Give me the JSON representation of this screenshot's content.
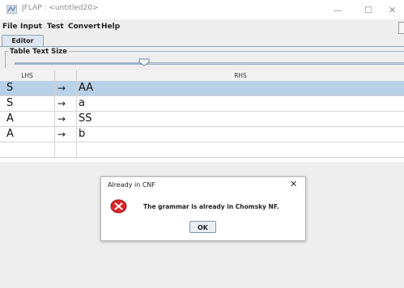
{
  "window": {
    "title": "JFLAP : <untitled20>",
    "controls": {
      "minimize": "—",
      "maximize": "☐",
      "close": "✕"
    }
  },
  "menu": [
    "File",
    "Input",
    "Test",
    "Convert",
    "Help"
  ],
  "tabs": [
    {
      "label": "Editor",
      "active": true
    }
  ],
  "table_text_size": {
    "label": "Table Text Size",
    "slider_value_fraction": 0.33
  },
  "grammar_table": {
    "columns": [
      "LHS",
      "",
      "RHS"
    ],
    "arrow": "→",
    "rows": [
      {
        "lhs": "S",
        "rhs": "AA",
        "selected": true
      },
      {
        "lhs": "S",
        "rhs": "a",
        "selected": false
      },
      {
        "lhs": "A",
        "rhs": "SS",
        "selected": false
      },
      {
        "lhs": "A",
        "rhs": "b",
        "selected": false
      },
      {
        "lhs": "",
        "rhs": "",
        "selected": false,
        "no_arrow": true
      }
    ]
  },
  "dialog": {
    "title": "Already in CNF",
    "close": "✕",
    "message": "The grammar is already in Chomsky NF.",
    "icon": "error-icon",
    "ok_label": "OK"
  },
  "colors": {
    "selection": "#b8d0e8",
    "tab": "#dde6f0",
    "error_red": "#d9262b"
  }
}
